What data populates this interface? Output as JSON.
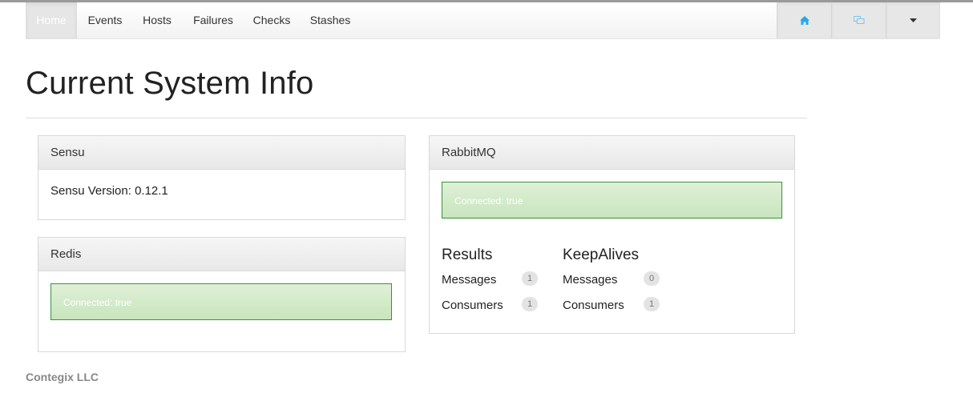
{
  "nav": {
    "items": [
      {
        "label": "Home",
        "active": true
      },
      {
        "label": "Events"
      },
      {
        "label": "Hosts"
      },
      {
        "label": "Failures"
      },
      {
        "label": "Checks"
      },
      {
        "label": "Stashes"
      }
    ],
    "right_icons": [
      "home-icon",
      "chat-icon",
      "caret-down-icon"
    ],
    "accent_color": "#27a9e3"
  },
  "page": {
    "title": "Current System Info"
  },
  "sensu": {
    "heading": "Sensu",
    "version_text": "Sensu Version: 0.12.1"
  },
  "redis": {
    "heading": "Redis",
    "status": "Connected: true"
  },
  "rabbitmq": {
    "heading": "RabbitMQ",
    "status": "Connected: true",
    "results": {
      "title": "Results",
      "messages_label": "Messages",
      "messages_count": "1",
      "consumers_label": "Consumers",
      "consumers_count": "1"
    },
    "keepalives": {
      "title": "KeepAlives",
      "messages_label": "Messages",
      "messages_count": "0",
      "consumers_label": "Consumers",
      "consumers_count": "1"
    }
  },
  "footer": {
    "text": "Contegix LLC"
  },
  "colors": {
    "success_bg": "#dff0d8",
    "success_border": "#3c8f40"
  }
}
